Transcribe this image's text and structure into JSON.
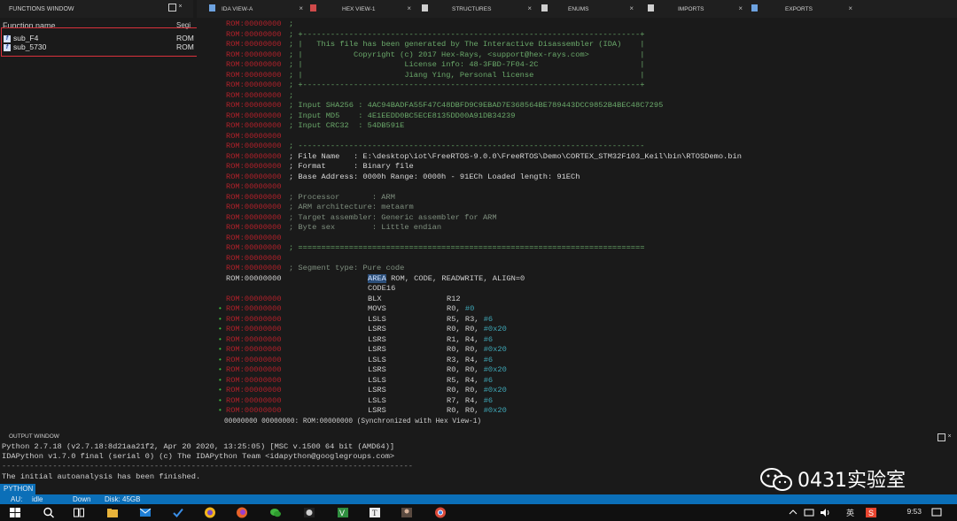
{
  "functions_window": {
    "title": "FUNCTIONS WINDOW",
    "col_name": "Function name",
    "col_segment": "Segi",
    "items": [
      {
        "name": "sub_F4",
        "segment": "ROM"
      },
      {
        "name": "sub_5730",
        "segment": "ROM"
      }
    ]
  },
  "tabs": [
    {
      "label": "IDA VIEW-A",
      "icon": "ida-view-icon"
    },
    {
      "label": "HEX VIEW-1",
      "icon": "hex-icon"
    },
    {
      "label": "STRUCTURES",
      "icon": "struct-icon"
    },
    {
      "label": "ENUMS",
      "icon": "enum-icon"
    },
    {
      "label": "IMPORTS",
      "icon": "import-icon"
    },
    {
      "label": "EXPORTS",
      "icon": "export-icon"
    }
  ],
  "disasm": {
    "header_lines": [
      ";",
      "; +-------------------------------------------------------------------------+",
      "; |   This file has been generated by The Interactive Disassembler (IDA)    |",
      "; |           Copyright (c) 2017 Hex-Rays, <support@hex-rays.com>           |",
      "; |                      License info: 48-3FBD-7F04-2C                      |",
      "; |                      Jiang Ying, Personal license                       |",
      "; +-------------------------------------------------------------------------+",
      ";",
      "; Input SHA256 : 4AC94BADFA55F47C48DBFD9C9EBAD7E368564BE789443DCC9852B4BEC48C7295",
      "; Input MD5    : 4E1EEDD0BC5ECE8135DD00A91DB34239",
      "; Input CRC32  : 54DB591E",
      "",
      "; ---------------------------------------------------------------------------",
      "; File Name   : E:\\desktop\\iot\\FreeRTOS-9.0.0\\FreeRTOS\\Demo\\CORTEX_STM32F103_Keil\\bin\\RTOSDemo.bin",
      "; Format      : Binary file",
      "; Base Address: 0000h Range: 0000h - 91ECh Loaded length: 91ECh",
      "",
      "; Processor       : ARM",
      "; ARM architecture: metaarm",
      "; Target assembler: Generic assembler for ARM",
      "; Byte sex        : Little endian",
      "",
      "; ===========================================================================",
      "",
      "; Segment type: Pure code"
    ],
    "seg_addr": "ROM:00000000",
    "seg_kw": "AREA",
    "seg_rest": " ROM, CODE, READWRITE, ALIGN=0",
    "code16": "CODE16",
    "instructions": [
      {
        "mn": "BLX",
        "ops": "R12"
      },
      {
        "mn": "MOVS",
        "ops": "R0, #0"
      },
      {
        "mn": "LSLS",
        "ops": "R5, R3, #6"
      },
      {
        "mn": "LSRS",
        "ops": "R0, R0, #0x20"
      },
      {
        "mn": "LSRS",
        "ops": "R1, R4, #6"
      },
      {
        "mn": "LSRS",
        "ops": "R0, R0, #0x20"
      },
      {
        "mn": "LSLS",
        "ops": "R3, R4, #6"
      },
      {
        "mn": "LSRS",
        "ops": "R0, R0, #0x20"
      },
      {
        "mn": "LSLS",
        "ops": "R5, R4, #6"
      },
      {
        "mn": "LSRS",
        "ops": "R0, R0, #0x20"
      },
      {
        "mn": "LSLS",
        "ops": "R7, R4, #6"
      },
      {
        "mn": "LSRS",
        "ops": "R0, R0, #0x20"
      }
    ],
    "sync_status": "00000000 00000000: ROM:00000000 (Synchronized with Hex View-1)"
  },
  "output_window": {
    "title": "OUTPUT WINDOW",
    "lines": [
      "Python 2.7.18 (v2.7.18:8d21aa21f2, Apr 20 2020, 13:25:05) [MSC v.1500 64 bit (AMD64)]",
      "IDAPython v1.7.0 final (serial 0) (c) The IDAPython Team <idapython@googlegroups.com>",
      "-----------------------------------------------------------------------------------------",
      "The initial autoanalysis has been finished."
    ],
    "python_button": "PYTHON"
  },
  "status_bar": {
    "au": "AU:",
    "au_state": "idle",
    "dir": "Down",
    "disk": "Disk: 45GB"
  },
  "taskbar": {
    "time": "9:53",
    "ime": "英"
  },
  "watermark": "0431实验室",
  "colors": {
    "accent": "#0b6fb8",
    "addr_red": "#b0212a",
    "comment_green": "#6aa86a",
    "highlight_box": "#d9313b"
  }
}
